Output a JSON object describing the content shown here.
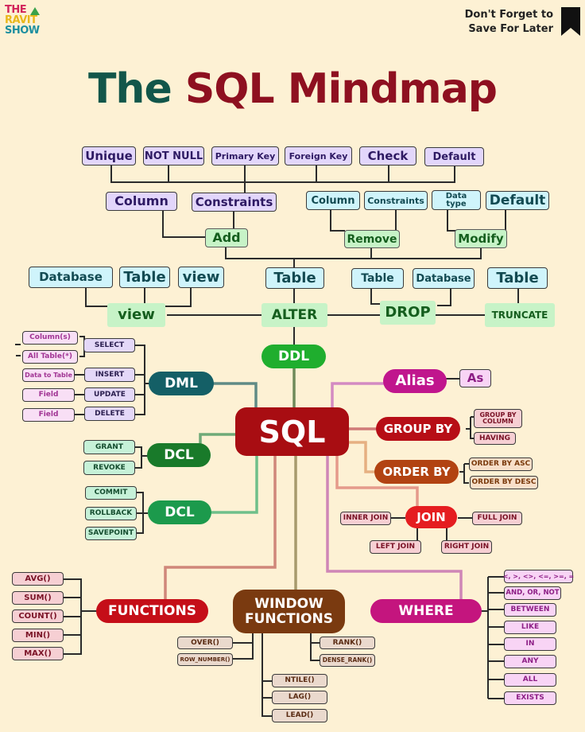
{
  "header": {
    "logo_lines": [
      "THE",
      "RAVIT",
      "SHOW"
    ],
    "save_note_lines": [
      "Don't Forget to",
      "Save For Later"
    ],
    "bookmark_icon": "bookmark-icon"
  },
  "title": {
    "part1": "The",
    "part2": "SQL Mindmap"
  },
  "colors": {
    "background": "#fdf1d4",
    "title_dark": "#12564a",
    "title_red": "#8e1020",
    "sql_root": "#a80d12",
    "ddl": "#1fae2e",
    "dml": "#145f66",
    "dcl": "#197a2a",
    "tcl": "#1c9a4c",
    "alias": "#c0168d",
    "group_by": "#b70e16",
    "order_by": "#b24312",
    "join": "#e51d20",
    "functions": "#c50e18",
    "window_functions": "#7a3a10",
    "where": "#c4157e"
  },
  "ddl": {
    "root": "SQL",
    "ddl_label": "DDL",
    "alter": {
      "label": "ALTER",
      "add": {
        "label": "Add",
        "children": [
          "Column",
          "Constraints"
        ],
        "constraint_types": [
          "Unique",
          "NOT NULL",
          "Primary Key",
          "Foreign Key",
          "Check",
          "Default"
        ]
      },
      "remove": {
        "label": "Remove",
        "children": [
          "Column",
          "Constraints"
        ]
      },
      "modify": {
        "label": "Modify",
        "children": [
          "Data type",
          "Default"
        ]
      },
      "table": "Table"
    },
    "view": {
      "label": "view",
      "children": [
        "Database",
        "Table",
        "view"
      ]
    },
    "drop": {
      "label": "DROP",
      "children": [
        "Table",
        "Database"
      ]
    },
    "truncate": {
      "label": "TRUNCATE",
      "children": [
        "Table"
      ]
    }
  },
  "dml": {
    "label": "DML",
    "commands": [
      {
        "label": "SELECT",
        "targets": [
          "Column(s)",
          "All Table(*)"
        ]
      },
      {
        "label": "INSERT",
        "targets": [
          "Data to Table"
        ]
      },
      {
        "label": "UPDATE",
        "targets": [
          "Field"
        ]
      },
      {
        "label": "DELETE",
        "targets": [
          "Field"
        ]
      }
    ]
  },
  "dcl": {
    "label": "DCL",
    "commands": [
      "GRANT",
      "REVOKE"
    ]
  },
  "tcl": {
    "label": "DCL",
    "commands": [
      "COMMIT",
      "ROLLBACK",
      "SAVEPOINT"
    ]
  },
  "alias": {
    "label": "Alias",
    "children": [
      "As"
    ]
  },
  "group_by": {
    "label": "GROUP BY",
    "children": [
      "GROUP BY COLUMN",
      "HAVING"
    ]
  },
  "order_by": {
    "label": "ORDER BY",
    "children": [
      "ORDER BY ASC",
      "ORDER BY DESC"
    ]
  },
  "join": {
    "label": "JOIN",
    "children": [
      "INNER JOIN",
      "FULL JOIN",
      "LEFT JOIN",
      "RIGHT JOIN"
    ]
  },
  "functions": {
    "label": "FUNCTIONS",
    "children": [
      "AVG()",
      "SUM()",
      "COUNT()",
      "MIN()",
      "MAX()"
    ]
  },
  "window_functions": {
    "label": "WINDOW FUNCTIONS",
    "children": [
      "OVER()",
      "ROW_NUMBER()",
      "RANK()",
      "DENSE_RANK()",
      "NTILE()",
      "LAG()",
      "LEAD()"
    ]
  },
  "where": {
    "label": "WHERE",
    "children": [
      "<, >, <>, <=, >=, =",
      "AND, OR, NOT",
      "BETWEEN",
      "LIKE",
      "IN",
      "ANY",
      "ALL",
      "EXISTS"
    ]
  }
}
